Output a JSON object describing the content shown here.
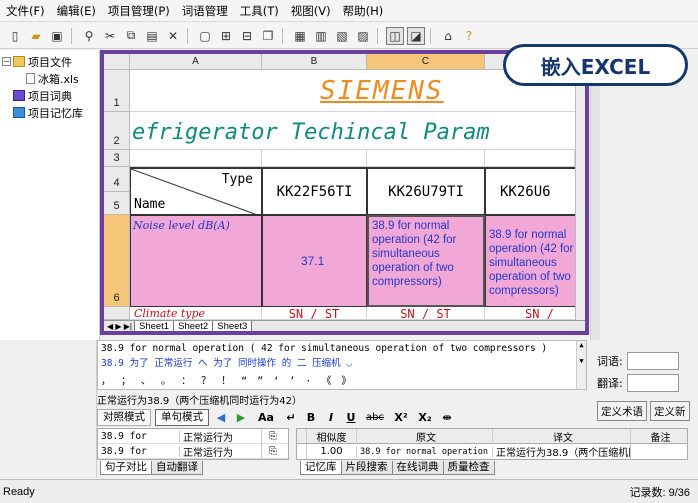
{
  "menu": [
    "文件(F)",
    "编辑(E)",
    "项目管理(P)",
    "词语管理",
    "工具(T)",
    "视图(V)",
    "帮助(H)"
  ],
  "tree": {
    "items": [
      {
        "label": "项目文件",
        "icon": "folder-icon"
      },
      {
        "label": "冰箱.xls",
        "icon": "file-icon"
      },
      {
        "label": "项目词典",
        "icon": "dictionary-icon"
      },
      {
        "label": "项目记忆库",
        "icon": "memory-icon"
      }
    ]
  },
  "badge": "嵌入EXCEL",
  "sheet": {
    "col_headers": [
      "A",
      "B",
      "C"
    ],
    "row_headers": [
      "1",
      "2",
      "3",
      "4",
      "5",
      "6"
    ],
    "brand": "SIEMENS",
    "title": "efrigerator Techincal Param",
    "type_label": "Type",
    "name_label": "Name",
    "models": [
      "KK22F56TI",
      "KK26U79TI",
      "KK26U6"
    ],
    "noise_label": "Noise level dB(A)",
    "noise_b": "37.1",
    "noise_c": "38.9 for normal operation (42 for simultaneous operation of two compressors)",
    "noise_d": "38.9 for normal operation (42 for simultaneous operation of two compressors)",
    "climate_label": "Climate type",
    "climate_b": "SN / ST",
    "climate_c": "SN / ST",
    "climate_d": "SN /",
    "tabs": [
      "Sheet1",
      "Sheet2",
      "Sheet3"
    ]
  },
  "editor": {
    "source": "38.9 for normal operation ( 42 for simultaneous operation of two compressors )",
    "target_tokens": "38.9 为了 正常运行    へ    为了 同时操作        的  二   压缩机        ◡",
    "punctuation": "， ； 、 。 ： ？ ！ “ ” ‘ ’ · 《 》",
    "result": "正常运行为38.9（两个压缩机同时运行为42）",
    "mode_compare": "对照模式",
    "mode_single": "单句模式",
    "fmt_bold": "B",
    "fmt_italic": "I",
    "fmt_underline": "U",
    "fmt_strike": "abc",
    "fmt_super": "X²",
    "fmt_sub": "X₂",
    "font_btn": "Aa"
  },
  "side": {
    "word_label": "词语:",
    "trans_label": "翻译:",
    "btn_define_term": "定义术语",
    "btn_define_new": "定义新"
  },
  "left_list": [
    {
      "src": "38.9 for",
      "tgt": "正常运行为"
    },
    {
      "src": "38.9 for",
      "tgt": "正常运行为"
    }
  ],
  "tm": {
    "headers": [
      "相似度",
      "原文",
      "译文",
      "备注"
    ],
    "rows": [
      {
        "score": "1.00",
        "src": "38.9 for normal operation (42",
        "tgt": "正常运行为38.9（两个压缩机同",
        "note": ""
      }
    ]
  },
  "bottom_tabs_left": [
    "句子对比",
    "自动翻译"
  ],
  "bottom_tabs_right": [
    "记忆库",
    "片段搜索",
    "在线词典",
    "质量检查"
  ],
  "status": {
    "left": "Ready",
    "right": "记录数: 9/36"
  }
}
